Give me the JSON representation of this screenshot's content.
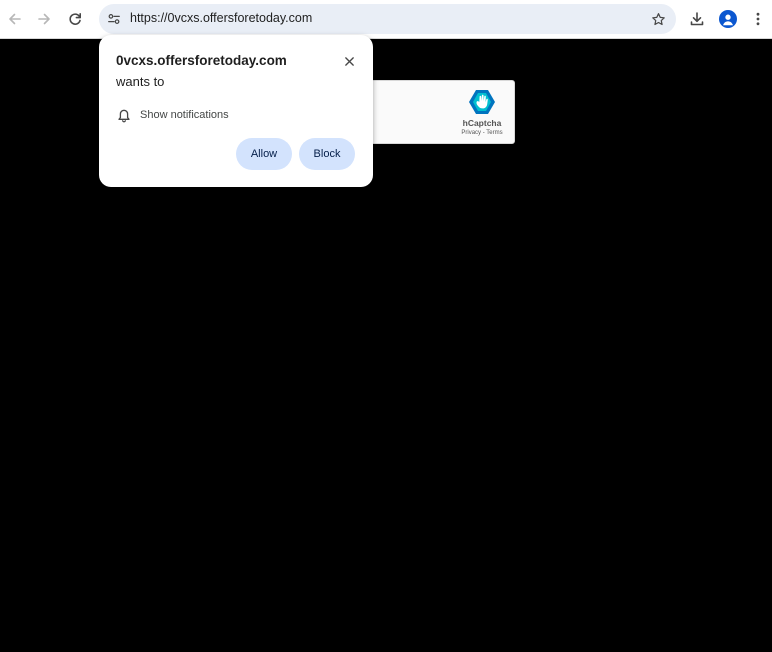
{
  "browser": {
    "url": "https://0vcxs.offersforetoday.com",
    "icons": {
      "back": "back-arrow-icon",
      "forward": "forward-arrow-icon",
      "reload": "reload-icon",
      "site_info": "tune-icon",
      "bookmark": "star-icon",
      "download": "download-icon",
      "profile": "person-icon",
      "menu": "more-vert-icon"
    }
  },
  "prompt": {
    "origin": "0vcxs.offersforetoday.com",
    "wants_to": "wants to",
    "permission_label": "Show notifications",
    "allow_label": "Allow",
    "block_label": "Block"
  },
  "captcha": {
    "brand": "hCaptcha",
    "links": "Privacy - Terms"
  },
  "colors": {
    "page_background": "#000000",
    "button_fill": "#d3e3fd",
    "omnibox_fill": "#e9eef6",
    "profile_accent": "#0b57d0",
    "captcha_logo": "#0074bf"
  }
}
